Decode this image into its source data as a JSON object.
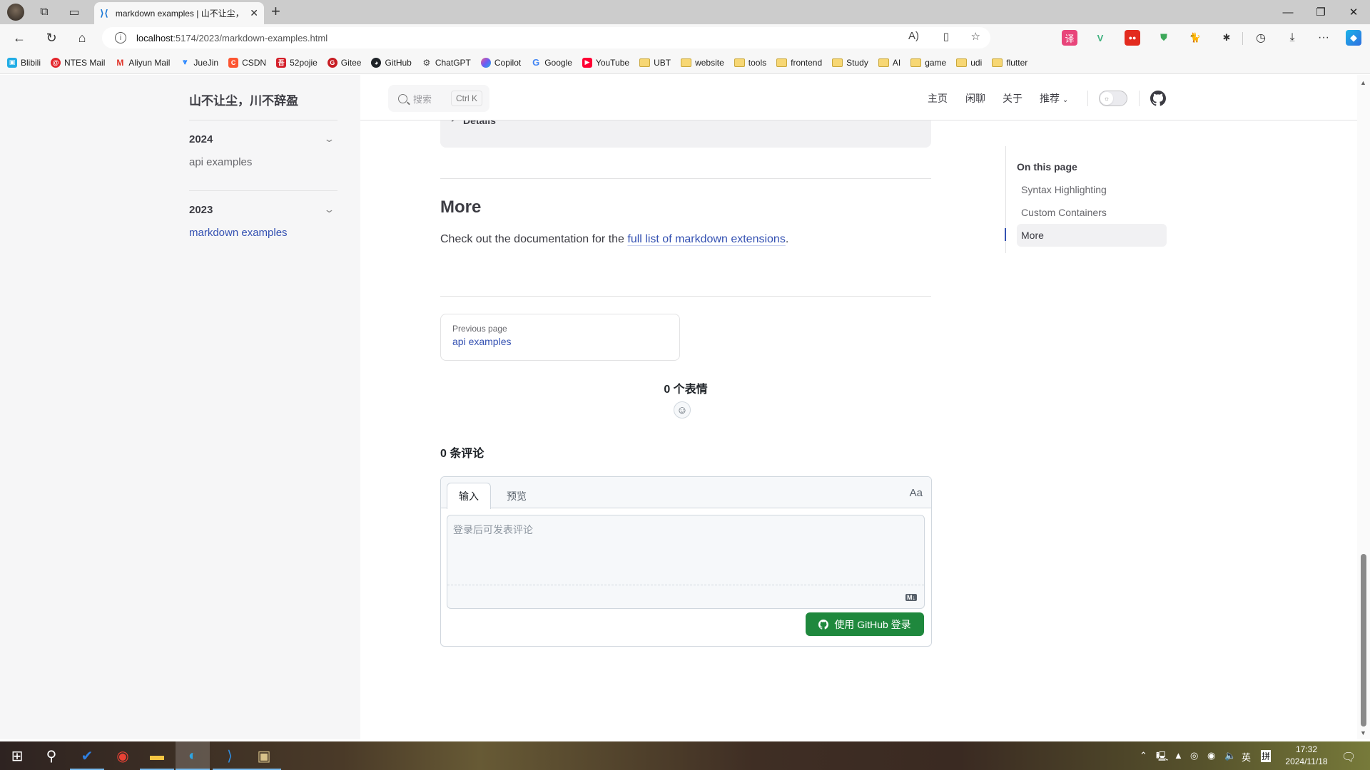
{
  "browser": {
    "tab_title": "markdown examples | 山不让尘，",
    "url_host": "localhost",
    "url_path": ":5174/2023/markdown-examples.html",
    "bookmarks": [
      {
        "label": "Blibili",
        "icon": "bilibili-icon",
        "color": "#23ade5"
      },
      {
        "label": "NTES Mail",
        "icon": "ntes-mail-icon",
        "color": "#e3252b"
      },
      {
        "label": "Aliyun Mail",
        "icon": "aliyun-mail-icon",
        "color": "#e0352b"
      },
      {
        "label": "JueJin",
        "icon": "juejin-icon",
        "color": "#1e80ff"
      },
      {
        "label": "CSDN",
        "icon": "csdn-icon",
        "color": "#fc5531"
      },
      {
        "label": "52pojie",
        "icon": "52pojie-icon",
        "color": "#d4202a"
      },
      {
        "label": "Gitee",
        "icon": "gitee-icon",
        "color": "#c71d23"
      },
      {
        "label": "GitHub",
        "icon": "github-icon",
        "color": "#1f2328"
      },
      {
        "label": "ChatGPT",
        "icon": "chatgpt-icon",
        "color": "#444444"
      },
      {
        "label": "Copilot",
        "icon": "copilot-icon",
        "color": "#6b5cf6"
      },
      {
        "label": "Google",
        "icon": "google-icon",
        "color": "#4285f4"
      },
      {
        "label": "YouTube",
        "icon": "youtube-icon",
        "color": "#ff0033"
      }
    ],
    "bookmark_folders": [
      "UBT",
      "website",
      "tools",
      "frontend",
      "Study",
      "AI",
      "game",
      "udi",
      "flutter"
    ]
  },
  "site": {
    "title": "山不让尘，川不辞盈",
    "search_placeholder": "搜索",
    "search_shortcut": "Ctrl K",
    "nav": [
      "主页",
      "闲聊",
      "关于",
      "推荐"
    ]
  },
  "sidebar": {
    "groups": [
      {
        "title": "2024",
        "items": [
          {
            "label": "api examples",
            "active": false
          }
        ]
      },
      {
        "title": "2023",
        "items": [
          {
            "label": "markdown examples",
            "active": true
          }
        ]
      }
    ]
  },
  "content": {
    "details_label": "Details",
    "heading": "More",
    "para_before": "Check out the documentation for the ",
    "para_link": "full list of markdown extensions",
    "para_after": ".",
    "prev_label": "Previous page",
    "prev_title": "api examples"
  },
  "comments": {
    "reactions": "0 个表情",
    "count": "0 条评论",
    "tab_write": "输入",
    "tab_preview": "预览",
    "font_toggle": "Aa",
    "placeholder": "登录后可发表评论",
    "md_badge": "M↓",
    "login_button": "使用 GitHub 登录",
    "accent": "#1f883d"
  },
  "toc": {
    "title": "On this page",
    "items": [
      {
        "label": "Syntax Highlighting",
        "active": false
      },
      {
        "label": "Custom Containers",
        "active": false
      },
      {
        "label": "More",
        "active": true
      }
    ]
  },
  "scroll": {
    "position_fraction": 1.0,
    "visible_fraction": 0.27
  },
  "taskbar": {
    "time": "17:32",
    "date": "2024/11/18",
    "ime_lang": "英",
    "ime_mode": "拼"
  }
}
